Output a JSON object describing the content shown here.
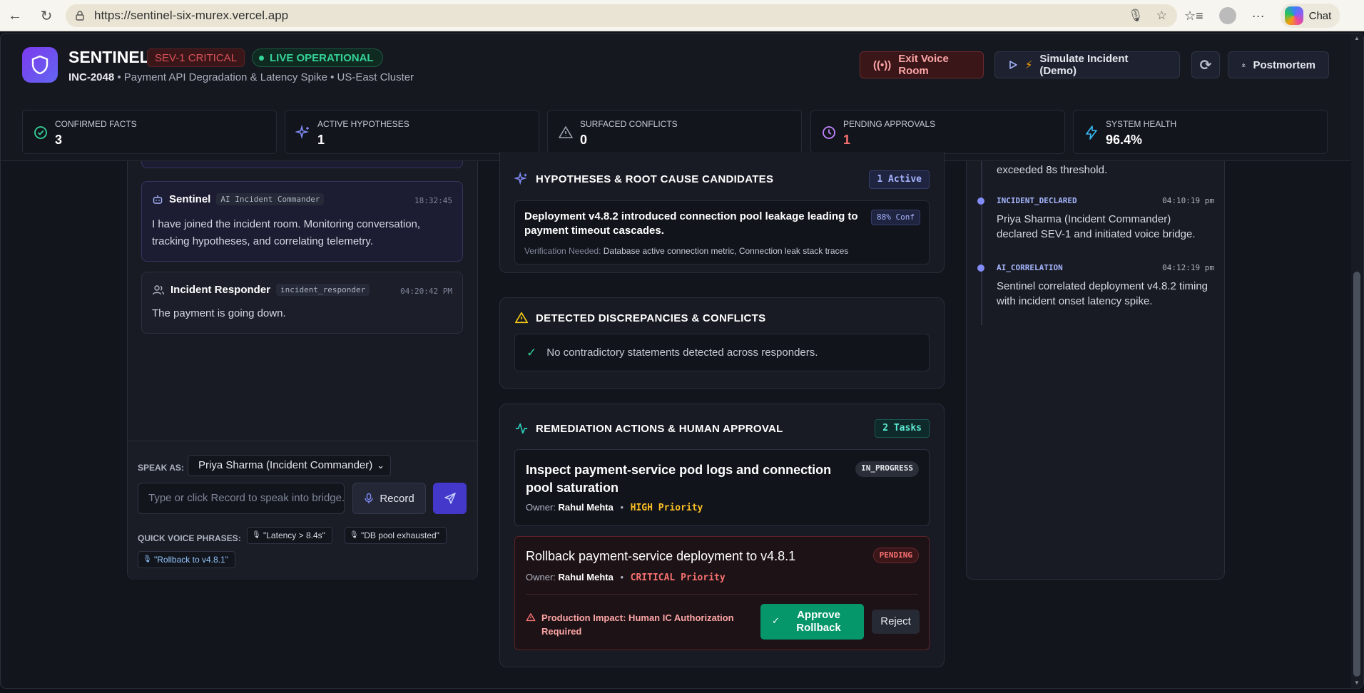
{
  "browser": {
    "url": "https://sentinel-six-murex.vercel.app",
    "chat_label": "Chat"
  },
  "header": {
    "brand": "SENTINEL",
    "severity": "SEV-1 CRITICAL",
    "status": "LIVE OPERATIONAL",
    "incident_id": "INC-2048",
    "incident_desc": "• Payment API Degradation & Latency Spike • US-East Cluster",
    "exit_label": "Exit Voice Room",
    "simulate_label": "Simulate Incident (Demo)",
    "postmortem_label": "Postmortem"
  },
  "stats": [
    {
      "label": "Confirmed Facts",
      "value": "3",
      "color": "#34d399",
      "icon": "check-circle-icon"
    },
    {
      "label": "Active Hypotheses",
      "value": "1",
      "color": "#818cf8",
      "icon": "sparkles-icon"
    },
    {
      "label": "Surfaced Conflicts",
      "value": "0",
      "color": "#9ca3af",
      "icon": "warning-icon"
    },
    {
      "label": "Pending Approvals",
      "value": "1",
      "color": "#c084fc",
      "icon": "clock-icon"
    },
    {
      "label": "System Health",
      "value": "96.4%",
      "color": "#38bdf8",
      "icon": "lightning-icon"
    }
  ],
  "chat": {
    "messages": [
      {
        "author": "Sentinel",
        "role": "AI Incident Commander",
        "time": "18:32:45",
        "text": "I have joined the incident room. Monitoring conversation, tracking hypotheses, and correlating telemetry."
      },
      {
        "author": "Incident Responder",
        "role": "incident_responder",
        "time": "04:20:42 PM",
        "text": "The payment is going down."
      }
    ],
    "speak_as_label": "SPEAK AS:",
    "speak_as_value": "Priya Sharma (Incident Commander)",
    "input_placeholder": "Type or click Record to speak into bridge...",
    "record_label": "Record",
    "quick_label": "QUICK VOICE PHRASES:",
    "quick_phrases": [
      "\"Latency > 8.4s\"",
      "\"DB pool exhausted\"",
      "\"Rollback to v4.8.1\""
    ]
  },
  "hypotheses": {
    "title": "HYPOTHESES & ROOT CAUSE CANDIDATES",
    "count": "1 Active",
    "items": [
      {
        "text": "Deployment v4.8.2 introduced connection pool leakage leading to payment timeout cascades.",
        "confidence": "88% Conf",
        "verify_label": "Verification Needed:",
        "verify_text": "Database active connection metric, Connection leak stack traces"
      }
    ]
  },
  "discrepancies": {
    "title": "DETECTED DISCREPANCIES & CONFLICTS",
    "empty_text": "No contradictory statements detected across responders."
  },
  "remediation": {
    "title": "REMEDIATION ACTIONS & HUMAN APPROVAL",
    "count": "2 Tasks",
    "tasks": [
      {
        "title": "Inspect payment-service pod logs and connection pool saturation",
        "state": "IN_PROGRESS",
        "owner_label": "Owner:",
        "owner": "Rahul Mehta",
        "priority": "HIGH Priority"
      },
      {
        "title": "Rollback payment-service deployment to v4.8.1",
        "state": "PENDING",
        "owner_label": "Owner:",
        "owner": "Rahul Mehta",
        "priority": "CRITICAL Priority",
        "impact": "Production Impact: Human IC Authorization Required",
        "approve_label": "Approve Rollback",
        "reject_label": "Reject"
      }
    ]
  },
  "timeline": {
    "partial_text": "exceeded 8s threshold.",
    "events": [
      {
        "type": "INCIDENT_DECLARED",
        "time": "04:10:19 pm",
        "desc": "Priya Sharma (Incident Commander) declared SEV-1 and initiated voice bridge."
      },
      {
        "type": "AI_CORRELATION",
        "time": "04:12:19 pm",
        "desc": "Sentinel correlated deployment v4.8.2 timing with incident onset latency spike."
      }
    ]
  }
}
